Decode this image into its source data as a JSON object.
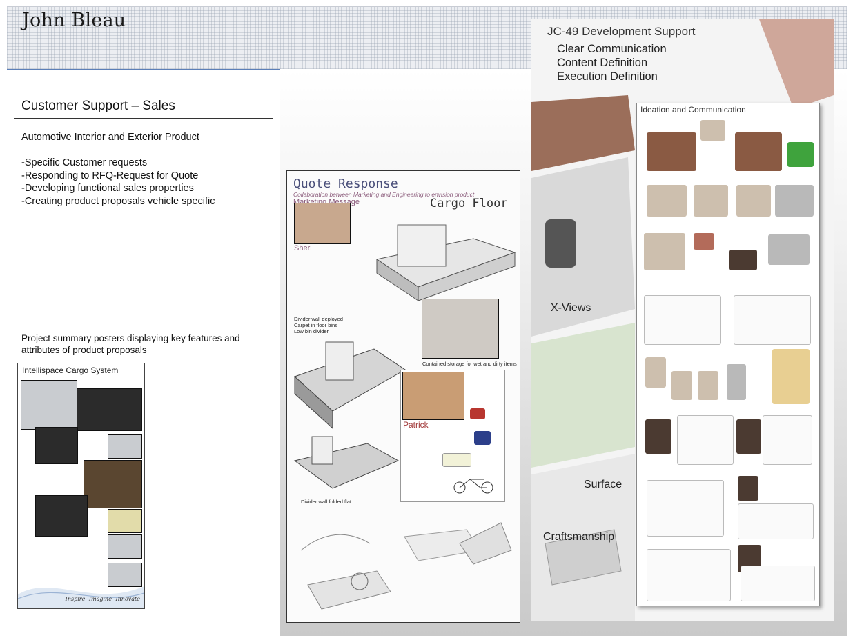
{
  "header": {
    "author": "John Bleau"
  },
  "section": {
    "title": "Customer Support – Sales",
    "subtitle": "Automotive Interior and Exterior Product",
    "bullets": [
      "-Specific Customer requests",
      "-Responding to RFQ-Request for Quote",
      "-Developing  functional sales properties",
      "-Creating product proposals vehicle specific"
    ],
    "summary": "Project summary posters displaying key features and attributes of product proposals"
  },
  "poster_cargo": {
    "title": "Intellispace Cargo System",
    "footer": "Inspire  Imagine  Innovate"
  },
  "poster_quote": {
    "title": "Quote Response",
    "subtitle1": "Collaboration between Marketing and Engineering to envision product",
    "subtitle2": "Marketing Message",
    "cargo": "Cargo Floor",
    "persona1": "Sheri",
    "persona2": "Patrick",
    "caption_divider": "Divider wall deployed",
    "caption_carpet": "Carpet in floor bins",
    "caption_low": "Low bin divider",
    "caption_storage": "Contained storage for wet and dirty items",
    "caption_folded": "Divider wall folded flat"
  },
  "poster_jc49": {
    "title": "JC-49 Development Support",
    "lines": [
      "Clear Communication",
      "Content Definition",
      "Execution Definition"
    ],
    "labels": {
      "xviews": "X-Views",
      "surface": "Surface",
      "craft": "Craftsmanship"
    },
    "card_title": "Ideation and Communication"
  },
  "colors": {
    "banner_rule": "#5b7fb8",
    "accent_text": "#4a4f7a"
  }
}
